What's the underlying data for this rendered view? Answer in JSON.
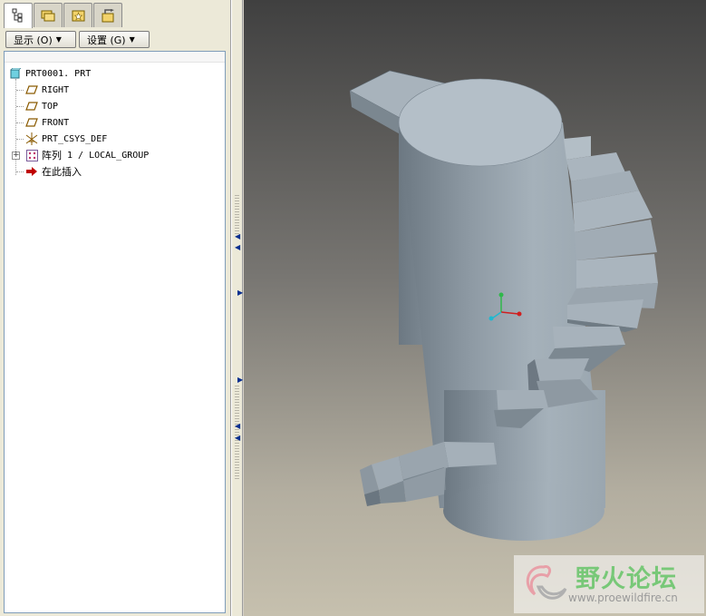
{
  "tabs": [
    {
      "name": "model-tree-tab",
      "icon": "model-tree-icon",
      "active": true
    },
    {
      "name": "folder-browser-tab",
      "icon": "folder-browser-icon",
      "active": false
    },
    {
      "name": "favorites-tab",
      "icon": "favorites-icon",
      "active": false
    },
    {
      "name": "connections-tab",
      "icon": "connections-icon",
      "active": false
    }
  ],
  "toolbar": {
    "show_label": "显示 (O)",
    "settings_label": "设置 (G)"
  },
  "tree": {
    "root": "PRT0001. PRT",
    "items": [
      {
        "label": "RIGHT",
        "icon": "datum-plane-icon"
      },
      {
        "label": "TOP",
        "icon": "datum-plane-icon"
      },
      {
        "label": "FRONT",
        "icon": "datum-plane-icon"
      },
      {
        "label": "PRT_CSYS_DEF",
        "icon": "coordinate-system-icon"
      },
      {
        "label_cn": "阵列",
        "label": "1 / LOCAL_GROUP",
        "icon": "pattern-icon",
        "expandable": true
      },
      {
        "label_cn": "在此插入",
        "icon": "insert-here-arrow-icon"
      }
    ]
  },
  "watermark": {
    "title": "野火论坛",
    "url": "www.proewildfire.cn"
  },
  "colors": {
    "model_light": "#aab6c0",
    "model_dark": "#6f7b85",
    "insert_arrow": "#c00000",
    "datum_plane": "#8a5a00"
  }
}
